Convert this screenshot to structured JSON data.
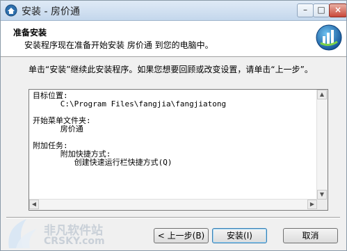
{
  "window": {
    "title": "安装 - 房价通"
  },
  "titlebar_buttons": {
    "minimize": "–",
    "maximize": "□",
    "close": "×"
  },
  "header": {
    "title": "准备安装",
    "subtitle": "安装程序现在准备开始安装 房价通 到您的电脑中。"
  },
  "instructions": "单击“安装”继续此安装程序。如果您想要回顾或改变设置，请单击“上一步”。",
  "details": {
    "lines": "目标位置:\n      C:\\Program Files\\fangjia\\fangjiatong\n\n开始菜单文件夹:\n      房价通\n\n附加任务:\n      附加快捷方式:\n         创建快速运行栏快捷方式(Q)"
  },
  "buttons": {
    "back": "< 上一步(B)",
    "install": "安装(I)",
    "cancel": "取消"
  },
  "watermark": {
    "cn": "非凡软件站",
    "en": "CRSKY.com"
  },
  "colors": {
    "accent": "#3c7fb1",
    "titlebar": "#c4d7ec"
  },
  "icons": {
    "app": "house-app-icon",
    "logo": "setup-logo-icon",
    "scroll_up": "scroll-up-arrow-icon",
    "scroll_down": "scroll-down-arrow-icon",
    "scroll_left": "scroll-left-arrow-icon",
    "scroll_right": "scroll-right-arrow-icon"
  }
}
